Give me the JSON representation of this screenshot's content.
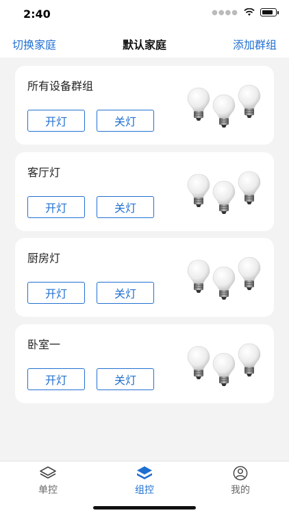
{
  "status": {
    "time": "2:40"
  },
  "nav": {
    "left": "切换家庭",
    "title": "默认家庭",
    "right": "添加群组"
  },
  "groups": [
    {
      "name": "所有设备群组",
      "on_label": "开灯",
      "off_label": "关灯"
    },
    {
      "name": "客厅灯",
      "on_label": "开灯",
      "off_label": "关灯"
    },
    {
      "name": "厨房灯",
      "on_label": "开灯",
      "off_label": "关灯"
    },
    {
      "name": "卧室一",
      "on_label": "开灯",
      "off_label": "关灯"
    }
  ],
  "tabs": [
    {
      "label": "单控",
      "icon": "layers-outline-icon",
      "active": false
    },
    {
      "label": "组控",
      "icon": "layers-filled-icon",
      "active": true
    },
    {
      "label": "我的",
      "icon": "user-icon",
      "active": false
    }
  ],
  "colors": {
    "accent": "#1f6fd1",
    "inactive": "#666666"
  }
}
